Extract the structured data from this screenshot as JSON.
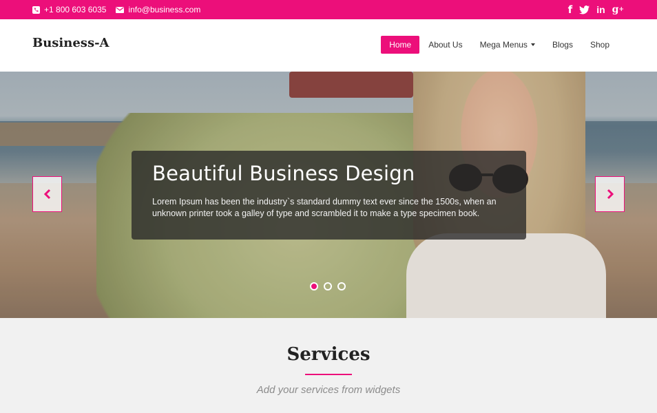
{
  "colors": {
    "accent": "#ec0f7a",
    "topbar_text": "#ffffff",
    "header_bg": "#ffffff",
    "section_bg": "#f1f1f1"
  },
  "topbar": {
    "phone_icon": "phone-icon",
    "phone": "+1 800 603 6035",
    "email_icon": "envelope-icon",
    "email": "info@business.com",
    "social": [
      {
        "icon": "facebook-icon",
        "glyph": "f"
      },
      {
        "icon": "twitter-icon",
        "glyph": ""
      },
      {
        "icon": "linkedin-icon",
        "glyph": "in"
      },
      {
        "icon": "google-plus-icon",
        "glyph": "g+"
      }
    ]
  },
  "header": {
    "logo": "Business-A",
    "nav": [
      {
        "label": "Home",
        "active": true
      },
      {
        "label": "About Us"
      },
      {
        "label": "Mega Menus",
        "dropdown": true
      },
      {
        "label": "Blogs"
      },
      {
        "label": "Shop"
      }
    ]
  },
  "slider": {
    "title": "Beautiful Business Design",
    "text": "Lorem Ipsum has been the industry`s standard dummy text ever since the 1500s, when an unknown printer took a galley of type and scrambled it to make a type specimen book.",
    "prev_icon": "chevron-left-icon",
    "next_icon": "chevron-right-icon",
    "slide_count": 3,
    "active_slide": 1
  },
  "services": {
    "title": "Services",
    "subtitle": "Add your services from widgets"
  }
}
